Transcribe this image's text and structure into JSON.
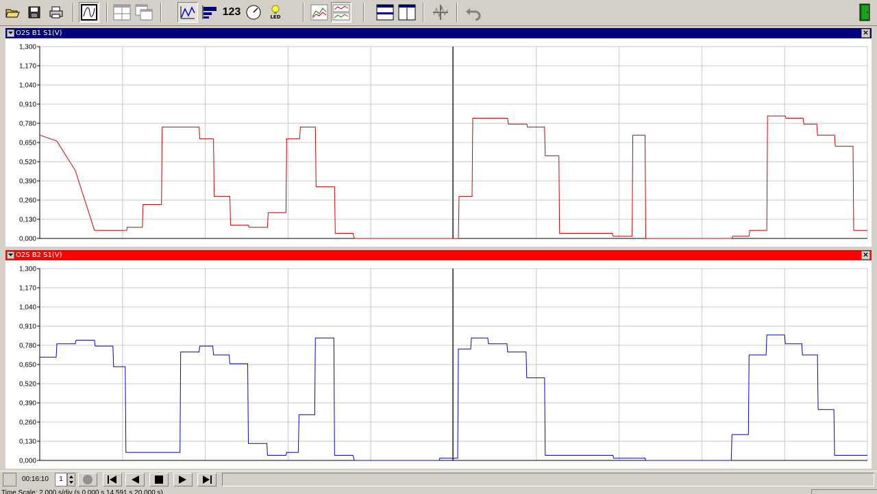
{
  "toolbar": {
    "buttons": [
      {
        "name": "open-icon",
        "group": 1
      },
      {
        "name": "save-icon",
        "group": 1
      },
      {
        "name": "print-icon",
        "group": 1
      },
      {
        "name": "graph-mode-icon",
        "group": 2,
        "pressed": true
      },
      {
        "name": "split-grid-icon",
        "group": 3
      },
      {
        "name": "overlay-windows-icon",
        "group": 3
      },
      {
        "name": "line-graph-icon",
        "group": 4,
        "pressed": true
      },
      {
        "name": "bar-graph-icon",
        "group": 4
      },
      {
        "name": "digital-readout-icon",
        "group": 4,
        "label": "123"
      },
      {
        "name": "gauge-icon",
        "group": 4
      },
      {
        "name": "led-icon",
        "group": 4,
        "label": "LED"
      },
      {
        "name": "single-chart-icon",
        "group": 5
      },
      {
        "name": "stacked-chart-icon",
        "group": 5,
        "pressed": true
      },
      {
        "name": "horizontal-split-icon",
        "group": 6
      },
      {
        "name": "vertical-split-icon",
        "group": 6
      },
      {
        "name": "trigger-icon",
        "group": 7
      },
      {
        "name": "undo-icon",
        "group": 8
      },
      {
        "name": "exit-icon",
        "group": 9
      }
    ]
  },
  "panels": [
    {
      "title": "O2S B1 S1(V)",
      "title_color": "#00007f",
      "trace_color": "#cc0000",
      "series": [
        [
          0,
          0.7
        ],
        [
          25,
          0.66
        ],
        [
          52,
          0.46
        ],
        [
          80,
          0.055
        ],
        [
          127,
          0.055
        ],
        [
          128,
          0.075
        ],
        [
          150,
          0.075
        ],
        [
          151,
          0.23
        ],
        [
          178,
          0.23
        ],
        [
          179,
          0.755
        ],
        [
          233,
          0.755
        ],
        [
          234,
          0.675
        ],
        [
          254,
          0.675
        ],
        [
          255,
          0.285
        ],
        [
          278,
          0.285
        ],
        [
          279,
          0.09
        ],
        [
          305,
          0.09
        ],
        [
          306,
          0.075
        ],
        [
          333,
          0.075
        ],
        [
          334,
          0.175
        ],
        [
          360,
          0.175
        ],
        [
          361,
          0.675
        ],
        [
          380,
          0.675
        ],
        [
          381,
          0.755
        ],
        [
          403,
          0.755
        ],
        [
          404,
          0.35
        ],
        [
          431,
          0.35
        ],
        [
          432,
          0.035
        ],
        [
          458,
          0.035
        ],
        [
          460,
          0.0
        ],
        [
          612,
          0.0
        ],
        [
          613,
          0.285
        ],
        [
          632,
          0.285
        ],
        [
          633,
          0.815
        ],
        [
          684,
          0.815
        ],
        [
          685,
          0.775
        ],
        [
          712,
          0.775
        ],
        [
          713,
          0.755
        ],
        [
          738,
          0.755
        ],
        [
          739,
          0.56
        ],
        [
          759,
          0.56
        ],
        [
          760,
          0.035
        ],
        [
          837,
          0.035
        ],
        [
          838,
          0.015
        ],
        [
          866,
          0.015
        ],
        [
          867,
          0.7
        ],
        [
          885,
          0.7
        ],
        [
          886,
          0.0
        ],
        [
          1012,
          0.0
        ],
        [
          1013,
          0.015
        ],
        [
          1037,
          0.015
        ],
        [
          1038,
          0.055
        ],
        [
          1063,
          0.055
        ],
        [
          1064,
          0.83
        ],
        [
          1090,
          0.83
        ],
        [
          1091,
          0.815
        ],
        [
          1116,
          0.815
        ],
        [
          1117,
          0.775
        ],
        [
          1136,
          0.775
        ],
        [
          1137,
          0.7
        ],
        [
          1162,
          0.7
        ],
        [
          1163,
          0.625
        ],
        [
          1189,
          0.625
        ],
        [
          1190,
          0.055
        ],
        [
          1210,
          0.055
        ]
      ]
    },
    {
      "title": "O2S B2 S1(V)",
      "title_color": "#ff0000",
      "trace_color": "#0000cc",
      "series": [
        [
          0,
          0.7
        ],
        [
          24,
          0.7
        ],
        [
          25,
          0.79
        ],
        [
          52,
          0.79
        ],
        [
          53,
          0.815
        ],
        [
          80,
          0.815
        ],
        [
          81,
          0.775
        ],
        [
          107,
          0.775
        ],
        [
          108,
          0.635
        ],
        [
          125,
          0.635
        ],
        [
          126,
          0.055
        ],
        [
          205,
          0.055
        ],
        [
          206,
          0.735
        ],
        [
          233,
          0.735
        ],
        [
          234,
          0.775
        ],
        [
          253,
          0.775
        ],
        [
          254,
          0.715
        ],
        [
          277,
          0.715
        ],
        [
          278,
          0.655
        ],
        [
          304,
          0.655
        ],
        [
          305,
          0.115
        ],
        [
          332,
          0.115
        ],
        [
          333,
          0.035
        ],
        [
          360,
          0.035
        ],
        [
          361,
          0.055
        ],
        [
          378,
          0.055
        ],
        [
          379,
          0.31
        ],
        [
          402,
          0.31
        ],
        [
          403,
          0.83
        ],
        [
          430,
          0.83
        ],
        [
          431,
          0.035
        ],
        [
          458,
          0.035
        ],
        [
          460,
          0.0
        ],
        [
          584,
          0.0
        ],
        [
          585,
          0.015
        ],
        [
          611,
          0.015
        ],
        [
          612,
          0.755
        ],
        [
          630,
          0.755
        ],
        [
          631,
          0.83
        ],
        [
          655,
          0.83
        ],
        [
          656,
          0.79
        ],
        [
          683,
          0.79
        ],
        [
          684,
          0.735
        ],
        [
          711,
          0.735
        ],
        [
          712,
          0.56
        ],
        [
          738,
          0.56
        ],
        [
          739,
          0.035
        ],
        [
          838,
          0.035
        ],
        [
          839,
          0.015
        ],
        [
          885,
          0.015
        ],
        [
          886,
          0.0
        ],
        [
          1011,
          0.0
        ],
        [
          1012,
          0.175
        ],
        [
          1036,
          0.175
        ],
        [
          1037,
          0.715
        ],
        [
          1062,
          0.715
        ],
        [
          1063,
          0.85
        ],
        [
          1089,
          0.85
        ],
        [
          1090,
          0.79
        ],
        [
          1114,
          0.79
        ],
        [
          1115,
          0.715
        ],
        [
          1137,
          0.715
        ],
        [
          1138,
          0.345
        ],
        [
          1161,
          0.345
        ],
        [
          1162,
          0.035
        ],
        [
          1210,
          0.035
        ]
      ]
    }
  ],
  "y_axis": {
    "min": 0,
    "max": 1.3,
    "ticks": [
      "0,000",
      "0,130",
      "0,260",
      "0,390",
      "0,520",
      "0,650",
      "0,780",
      "0,910",
      "1,040",
      "1,170",
      "1,300"
    ]
  },
  "x_axis": {
    "min": 0,
    "max": 1210,
    "divisions": 10,
    "cursor": 604
  },
  "playback": {
    "time": "00:16:10",
    "step": "1"
  },
  "status": {
    "text": "Time Scale: 2,000 s/div (s 0,000 s 14,591 s 20,000 s)"
  },
  "chart_data": [
    {
      "type": "line",
      "title": "O2S B1 S1(V)",
      "ylim": [
        0,
        1.3
      ],
      "series": [
        {
          "name": "O2S B1 S1(V)",
          "ref": "panels.0.series"
        }
      ]
    },
    {
      "type": "line",
      "title": "O2S B2 S1(V)",
      "ylim": [
        0,
        1.3
      ],
      "series": [
        {
          "name": "O2S B2 S1(V)",
          "ref": "panels.1.series"
        }
      ]
    }
  ]
}
